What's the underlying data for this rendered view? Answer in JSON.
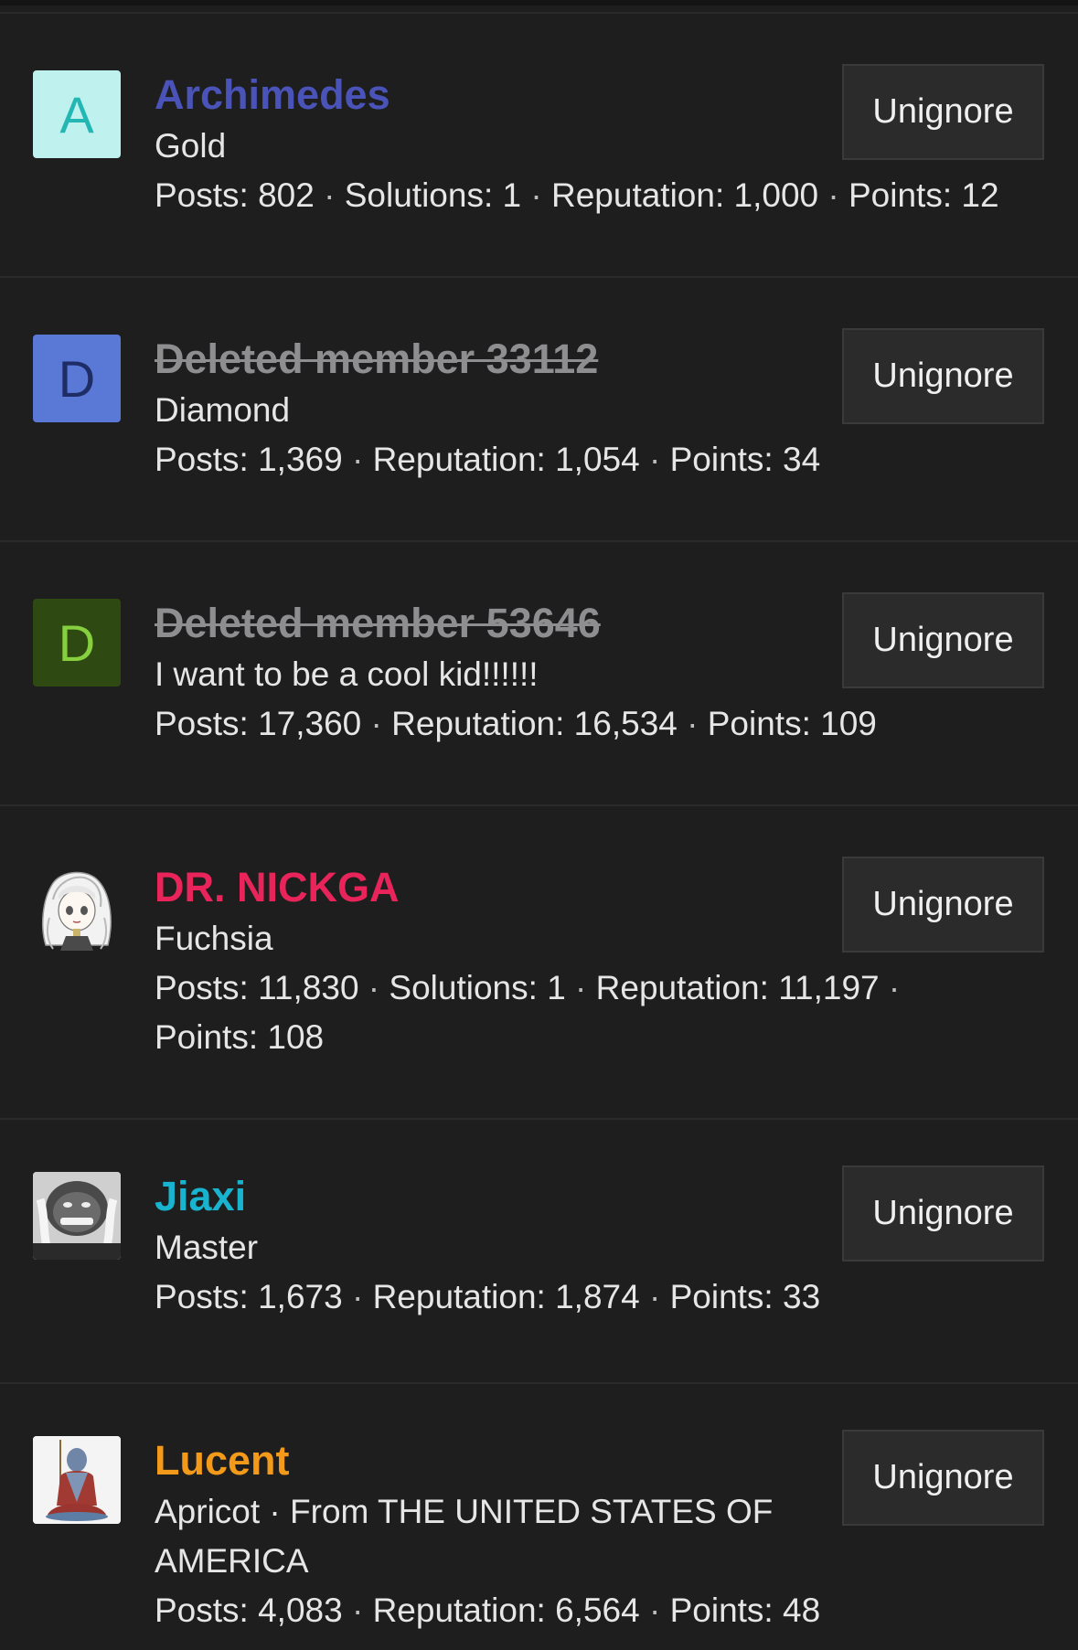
{
  "button_label": "Unignore",
  "members": [
    {
      "name": "Archimedes",
      "name_color": "#4a54b8",
      "deleted": false,
      "avatar": {
        "type": "letter",
        "letter": "A",
        "bg": "#bff1ef",
        "fg": "#23b7b4"
      },
      "title": "Gold",
      "stats": [
        "Posts: 802",
        "Solutions: 1",
        "Reputation: 1,000",
        "Points: 12"
      ]
    },
    {
      "name": "Deleted member 33112",
      "name_color": "#8e8e90",
      "deleted": true,
      "avatar": {
        "type": "letter",
        "letter": "D",
        "bg": "#5a78d6",
        "fg": "#1f2d66"
      },
      "title": "Diamond",
      "stats": [
        "Posts: 1,369",
        "Reputation: 1,054",
        "Points: 34"
      ]
    },
    {
      "name": "Deleted member 53646",
      "name_color": "#8e8e90",
      "deleted": true,
      "avatar": {
        "type": "letter",
        "letter": "D",
        "bg": "#2e4a12",
        "fg": "#86cf3e"
      },
      "title": "I want to be a cool kid!!!!!!",
      "stats": [
        "Posts: 17,360",
        "Reputation: 16,534",
        "Points: 109"
      ]
    },
    {
      "name": "DR. NICKGA",
      "name_color": "#e8245a",
      "deleted": false,
      "avatar": {
        "type": "image",
        "icon": "anime-girl-avatar-icon"
      },
      "title": "Fuchsia",
      "stats": [
        "Posts: 11,830",
        "Solutions: 1",
        "Reputation: 11,197",
        "Points: 108"
      ]
    },
    {
      "name": "Jiaxi",
      "name_color": "#18b3cf",
      "deleted": false,
      "avatar": {
        "type": "image",
        "icon": "face-photo-avatar-icon"
      },
      "title": "Master",
      "stats": [
        "Posts: 1,673",
        "Reputation: 1,874",
        "Points: 33"
      ]
    },
    {
      "name": "Lucent",
      "name_color": "#f39a1a",
      "deleted": false,
      "avatar": {
        "type": "image",
        "icon": "statue-avatar-icon"
      },
      "title": "Apricot · From THE UNITED STATES OF AMERICA",
      "stats": [
        "Posts: 4,083",
        "Reputation: 6,564",
        "Points: 48"
      ]
    }
  ]
}
